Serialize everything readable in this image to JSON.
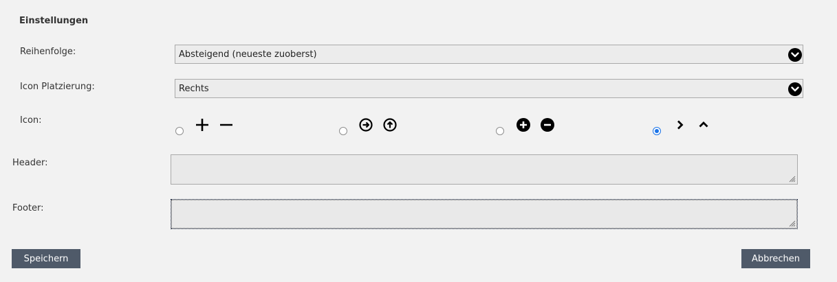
{
  "section_title": "Einstellungen",
  "order": {
    "label": "Reihenfolge:",
    "value": "Absteigend (neueste zuoberst)"
  },
  "icon_placement": {
    "label": "Icon Platzierung:",
    "value": "Rechts"
  },
  "icon": {
    "label": "Icon:",
    "options": [
      {
        "icons": [
          "plus-icon",
          "minus-icon"
        ],
        "selected": false
      },
      {
        "icons": [
          "circle-arrow-right-icon",
          "circle-arrow-up-icon"
        ],
        "selected": false
      },
      {
        "icons": [
          "circle-plus-icon",
          "circle-minus-icon"
        ],
        "selected": false
      },
      {
        "icons": [
          "chevron-right-icon",
          "chevron-up-icon"
        ],
        "selected": true
      }
    ]
  },
  "header": {
    "label": "Header:",
    "value": ""
  },
  "footer": {
    "label": "Footer:",
    "value": ""
  },
  "buttons": {
    "save": "Speichern",
    "cancel": "Abbrechen"
  },
  "colors": {
    "button_bg": "#4f5a69",
    "radio_selected": "#1a73e8",
    "background": "#f2f2f2"
  }
}
